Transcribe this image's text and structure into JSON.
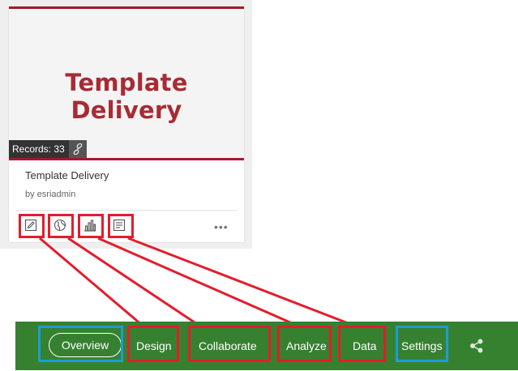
{
  "card": {
    "thumbnail_title": "Template Delivery",
    "records_label": "Records: 33",
    "link_icon": "link-icon",
    "title": "Template Delivery",
    "owner": "by esriadmin",
    "actions": [
      "edit-icon",
      "globe-icon",
      "bar-chart-icon",
      "data-table-icon"
    ],
    "more_label": "•••"
  },
  "navbar": {
    "items": [
      "Overview",
      "Design",
      "Collaborate",
      "Analyze",
      "Data",
      "Settings"
    ],
    "active": "Overview",
    "share_icon": "share-icon"
  },
  "colors": {
    "navbar_bg": "#368130",
    "highlight_red": "#e41c2c",
    "highlight_blue": "#1e9bd6",
    "thumbnail_accent": "#a11c2c"
  }
}
